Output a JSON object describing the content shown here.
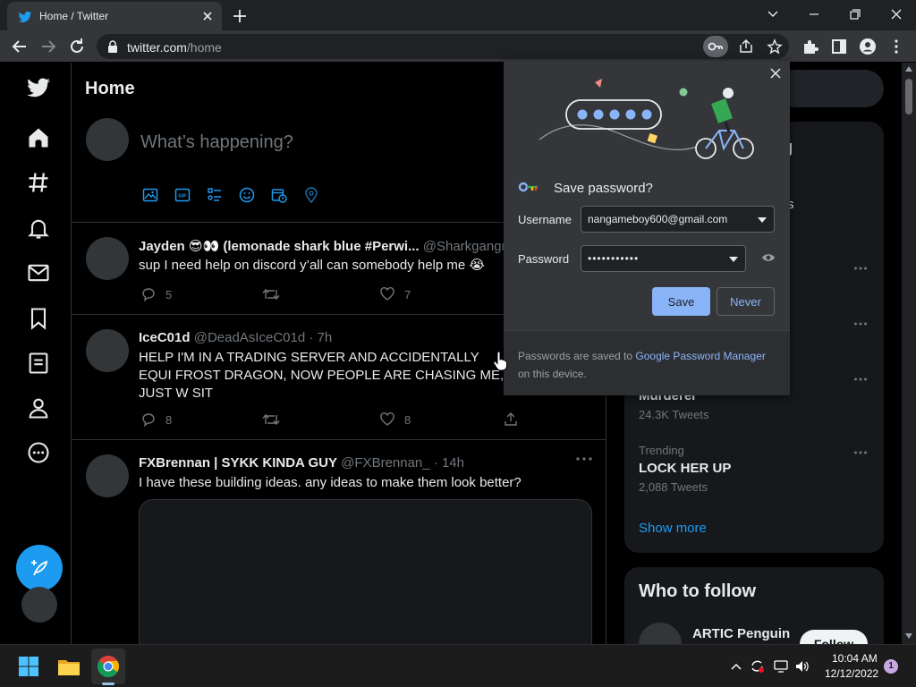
{
  "browser": {
    "tab_title": "Home / Twitter",
    "url_host": "twitter.com",
    "url_path": "/home"
  },
  "twitter": {
    "page_title": "Home",
    "compose_placeholder": "What’s happening?",
    "tweets": [
      {
        "name": "Jayden 😎👀 (lemonade shark blue #Perwi...",
        "handle": "@Sharkgangr",
        "text": "sup I need help on discord y’all can somebody help me 😭",
        "replies": "5",
        "likes": "7"
      },
      {
        "name": "IceC01d",
        "handle": "@DeadAsIceC01d · 7h",
        "text": "HELP I'M IN A TRADING SERVER AND ACCIDENTALLY EQUI FROST DRAGON, NOW PEOPLE ARE CHASING ME, I JUST W SIT",
        "replies": "8",
        "likes": "8"
      },
      {
        "name": "FXBrennan | SYKK KINDA GUY",
        "handle": "@FXBrennan_ · 14h",
        "text": "I have these building ideas. any ideas to make them look better?"
      }
    ],
    "trends": {
      "title_fragment": "g",
      "frag_s": "s",
      "frag_murderer": "Murderer",
      "murderer_count": "24.3K Tweets",
      "trend_label": "Trending",
      "trend_name": "LOCK HER UP",
      "trend_count": "2,088 Tweets",
      "show_more": "Show more"
    },
    "who_to_follow": {
      "title": "Who to follow",
      "name": "ARTIC Penguin",
      "follow_label": "Follow"
    }
  },
  "password_bubble": {
    "title": "Save password?",
    "username_label": "Username",
    "username_value": "nangameboy600@gmail.com",
    "password_label": "Password",
    "password_value": "•••••••••••",
    "save_label": "Save",
    "never_label": "Never",
    "footer_prefix": "Passwords are saved to ",
    "footer_link": "Google Password Manager",
    "footer_suffix": " on this device."
  },
  "taskbar": {
    "time": "10:04 AM",
    "date": "12/12/2022",
    "notification_count": "1"
  },
  "colors": {
    "twitter_blue": "#1d9bf0",
    "chrome_blue": "#8ab4f8",
    "background": "#000000"
  }
}
